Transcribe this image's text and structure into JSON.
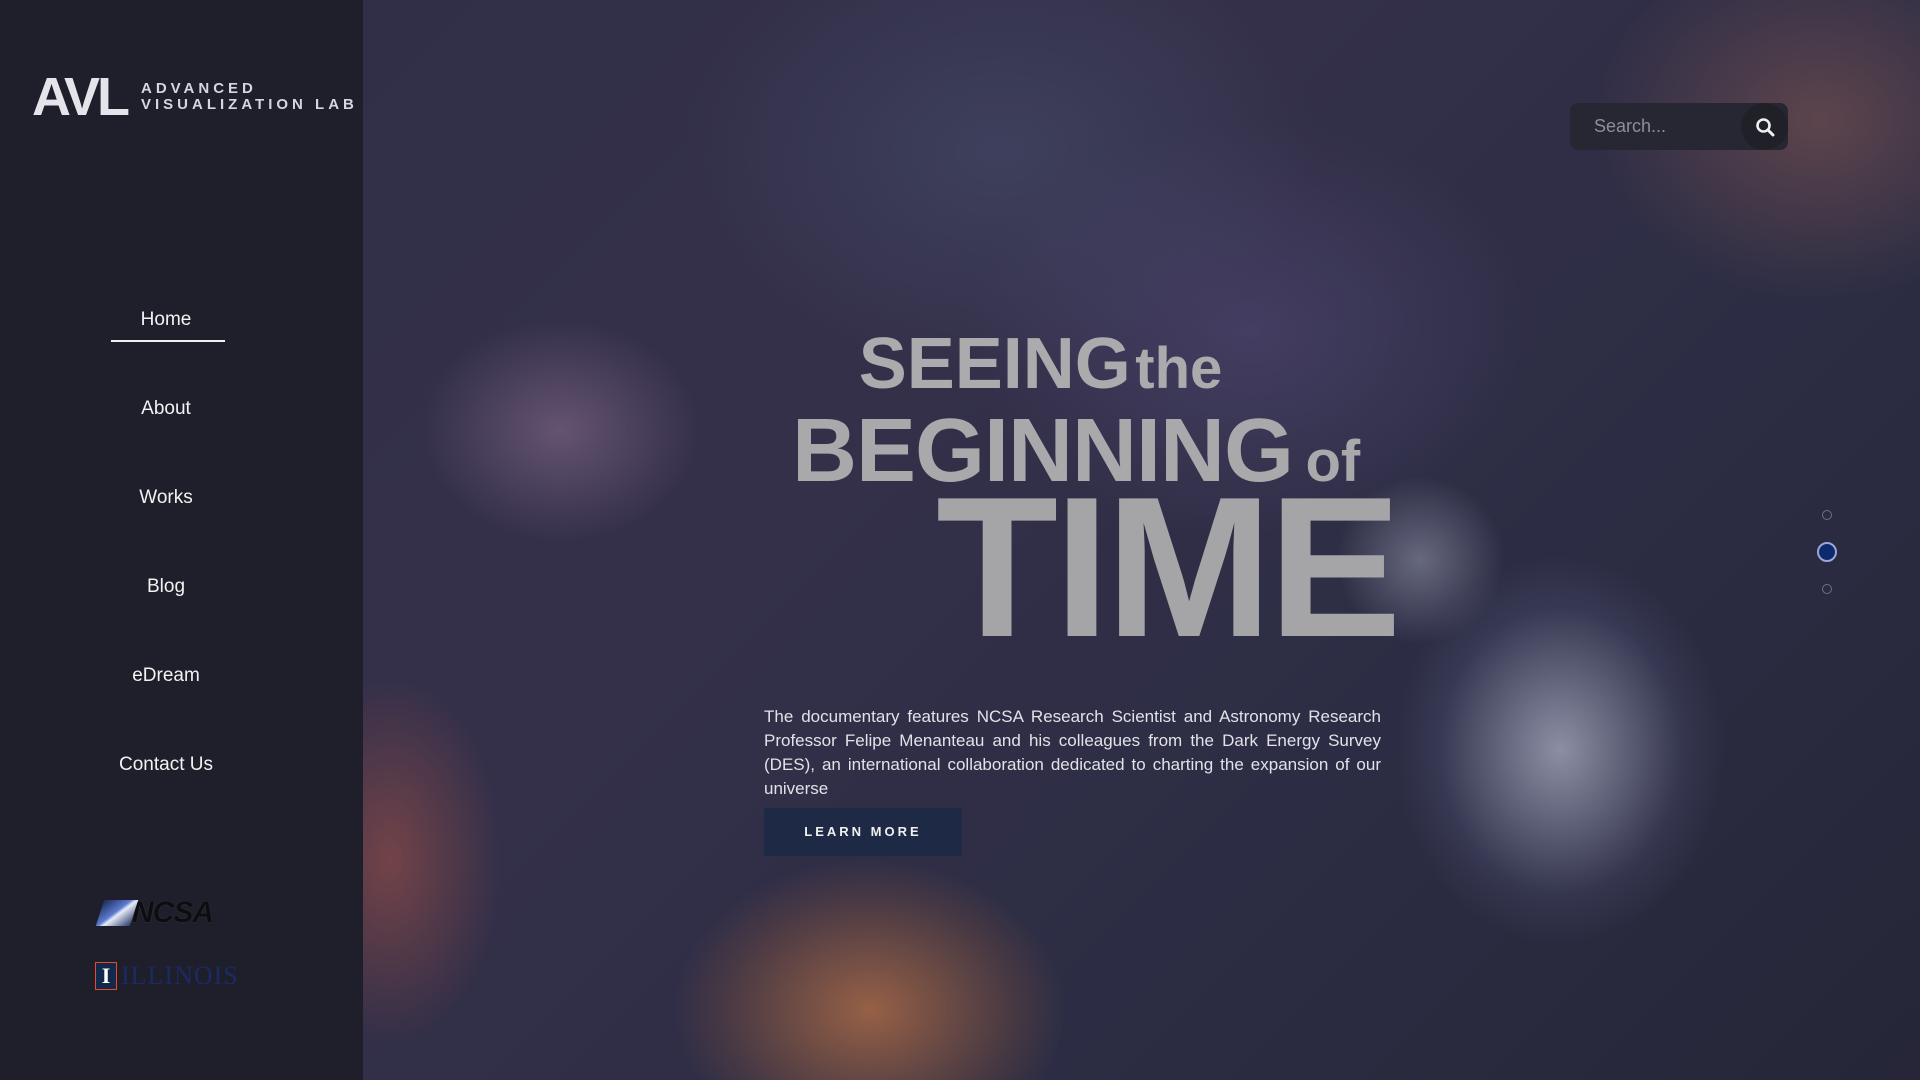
{
  "brand": {
    "mark": "AVL",
    "line1": "ADVANCED",
    "line2": "VISUALIZATION LAB"
  },
  "nav": {
    "items": [
      {
        "label": "Home",
        "active": true
      },
      {
        "label": "About"
      },
      {
        "label": "Works"
      },
      {
        "label": "Blog"
      },
      {
        "label": "eDream"
      },
      {
        "label": "Contact Us"
      }
    ]
  },
  "partners": {
    "ncsa": "NCSA",
    "illinois_mark": "I",
    "illinois": "ILLINOIS"
  },
  "search": {
    "placeholder": "Search...",
    "icon": "search-icon"
  },
  "hero": {
    "line1_big": "SEEING",
    "line1_small": "the",
    "line2_big": "BEGINNING",
    "line2_small": "of",
    "line3": "TIME",
    "description": "The documentary features NCSA Research Scientist and Astronomy Research Professor Felipe Menanteau and his colleagues from the Dark Energy Survey (DES), an international collaboration dedicated to charting the expansion of our universe",
    "button": "LEARN MORE"
  },
  "slider": {
    "count": 3,
    "active_index": 2
  },
  "colors": {
    "sidebar": "#1f1f2b",
    "button": "#1e2a45",
    "active_dot": "#0d2a6e"
  }
}
